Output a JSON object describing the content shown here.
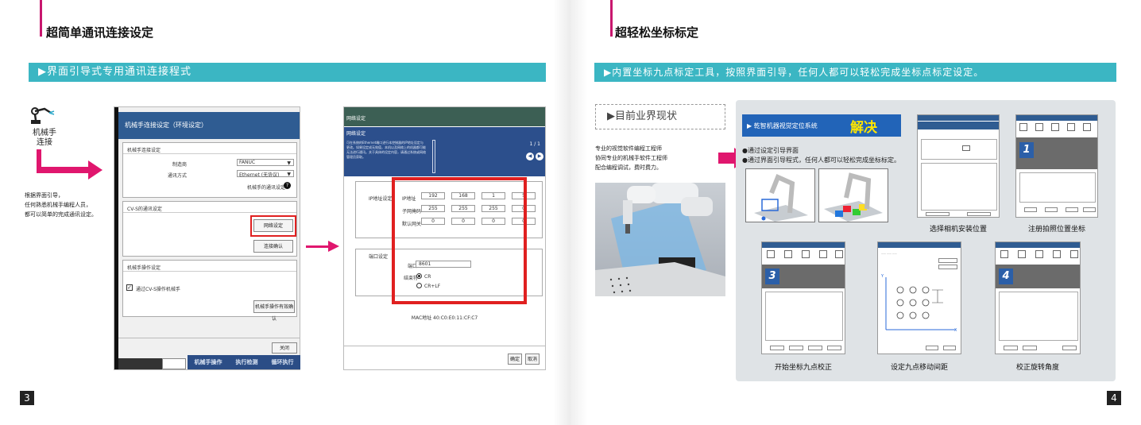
{
  "left": {
    "section_title": "超简单通讯连接设定",
    "banner": "▶界面引导式专用通讯连接程式",
    "robot_label": "机械手\n连接",
    "description": "根据界面引导，\n任何熟悉机械手编程人员，\n都可以简单的完成通讯设定。",
    "page_number": "3",
    "window1": {
      "title": "机械手连接设定（环境设定）",
      "group1_title": "机械手连接设定",
      "maker_label": "制造商",
      "maker_value": "FANUC",
      "comm_label": "通讯方式",
      "comm_value": "Ethernet (无协议)",
      "comm_setting": "机械手的通讯设定",
      "group2_title": "CV-S的通讯设定",
      "network_button": "网络设定",
      "confirm_button": "连接确认",
      "group3_title": "机械手操作设定",
      "checkbox_label": "通过CV-S操作机械手",
      "enable_button": "机械手操作有效确认",
      "close_button": "关闭",
      "bottom_buttons": [
        "机械手操作",
        "执行检测",
        "循环执行"
      ]
    },
    "window2": {
      "title": "网络设定",
      "subtitle": "网络设定",
      "notice": "可在系统的Ethernet端口进行本控制器的IP地址设定与更改。如果设定成无效值，本机以及网络上的机器都可能无法进行通讯。关于具体的设定内容，请通过系统或网络管理员获取。",
      "paging": "1 / 1",
      "ip_group": "IP地址设定",
      "ip_label": "IP地址",
      "ip_values": [
        "192",
        "168",
        "1",
        "5"
      ],
      "mask_label": "子网掩码",
      "mask_values": [
        "255",
        "255",
        "255",
        "0"
      ],
      "gateway_label": "默认网关",
      "gateway_values": [
        "0",
        "0",
        "0",
        "0"
      ],
      "port_group": "端口设定",
      "port_label": "端口",
      "port_value": "8601",
      "delimiter_label": "结束符",
      "delimiter_cr": "CR",
      "delimiter_crlf": "CR+LF",
      "mac": "MAC地址  40:C0:E0:11:CF:C7",
      "ok_button": "确定",
      "cancel_button": "取消"
    }
  },
  "right": {
    "section_title": "超轻松坐标标定",
    "banner": "▶内置坐标九点标定工具，按照界面引导，任何人都可以轻松完成坐标点标定设定。",
    "status_box": "▶目前业界现状",
    "status_text": "专业的视觉软件编程工程师\n协同专业的机械手软件工程师\n配合编程调试，费时费力。",
    "solution_system": "▶ 乾智机器视觉定位系统",
    "solution_word": "解决",
    "bullet1": "●通过设定引导界面",
    "bullet2": "●通过界面引导程式，任何人都可以轻松完成坐标标定。",
    "captions": [
      "选择相机安装位置",
      "注册拍照位置坐标",
      "开始坐标九点校正",
      "设定九点移动间距",
      "校正旋转角度"
    ],
    "steps": [
      "1",
      "3",
      "4"
    ],
    "grid_labels": [
      "X",
      "Y"
    ],
    "page_number": "4"
  },
  "colors": {
    "accent_pink": "#e0166e",
    "banner_teal": "#3bb6c3",
    "title_blue": "#2f5c92",
    "highlight_red": "#e02020"
  }
}
